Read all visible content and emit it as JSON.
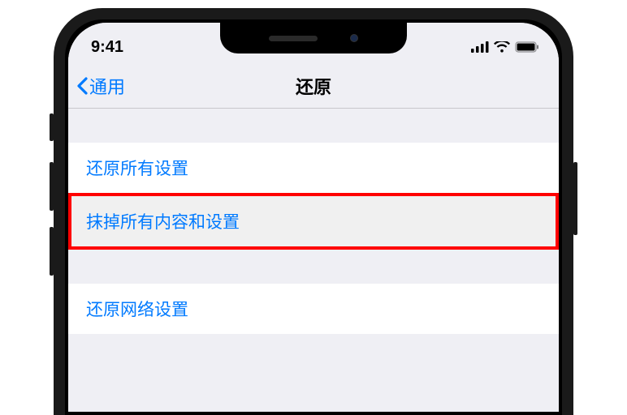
{
  "status": {
    "time": "9:41"
  },
  "nav": {
    "back_label": "通用",
    "title": "还原"
  },
  "rows": {
    "reset_all_settings": "还原所有设置",
    "erase_all_content": "抹掉所有内容和设置",
    "reset_network": "还原网络设置"
  }
}
